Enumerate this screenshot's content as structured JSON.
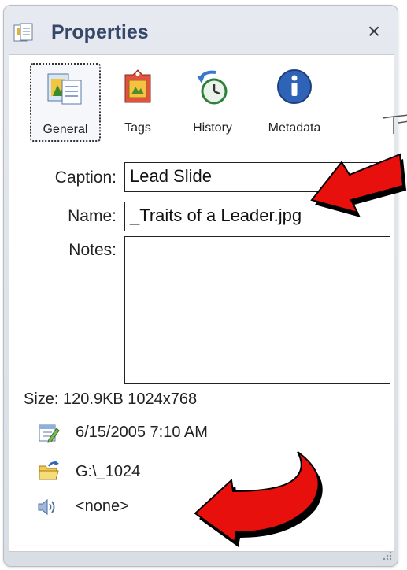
{
  "window": {
    "title": "Properties",
    "close_glyph": "×"
  },
  "tabs": [
    {
      "label": "General",
      "icon": "general-icon",
      "active": true
    },
    {
      "label": "Tags",
      "icon": "tags-icon",
      "active": false
    },
    {
      "label": "History",
      "icon": "history-icon",
      "active": false
    },
    {
      "label": "Metadata",
      "icon": "metadata-icon",
      "active": false
    }
  ],
  "form": {
    "caption_label": "Caption:",
    "caption_value": "Lead Slide",
    "name_label": "Name:",
    "name_value": "_Traits of a Leader.jpg",
    "notes_label": "Notes:",
    "notes_value": ""
  },
  "info": {
    "size": "Size: 120.9KB  1024x768",
    "date": "6/15/2005 7:10 AM",
    "folder": "G:\\_1024",
    "audio": "<none>"
  },
  "colors": {
    "arrow": "#e8100c",
    "title": "#37476a",
    "accent_blue": "#2f63b8"
  }
}
